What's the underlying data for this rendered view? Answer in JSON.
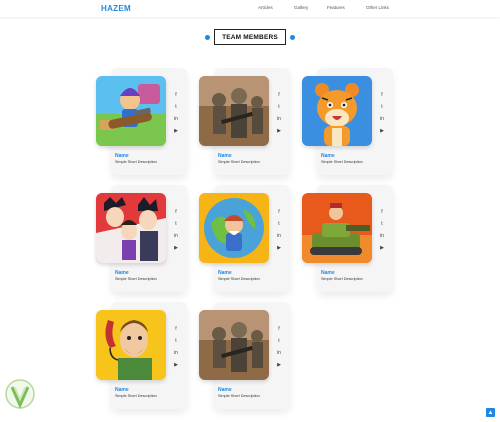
{
  "header": {
    "logo": "HAZEM",
    "nav": [
      {
        "label": "Articles"
      },
      {
        "label": "Gallery"
      },
      {
        "label": "Features"
      },
      {
        "label": "Other Links"
      }
    ]
  },
  "section": {
    "title": "TEAM MEMBERS"
  },
  "members": [
    {
      "name": "Name",
      "description": "Simple Short Description",
      "image": "boom-beach-warrior"
    },
    {
      "name": "Name",
      "description": "Simple Short Description",
      "image": "soldiers-battle"
    },
    {
      "name": "Name",
      "description": "Simple Short Description",
      "image": "cartoon-tiger"
    },
    {
      "name": "Name",
      "description": "Simple Short Description",
      "image": "anime-characters"
    },
    {
      "name": "Name",
      "description": "Simple Short Description",
      "image": "globe-adventurer"
    },
    {
      "name": "Name",
      "description": "Simple Short Description",
      "image": "tank-cartoon"
    },
    {
      "name": "Name",
      "description": "Simple Short Description",
      "image": "man-telephone"
    },
    {
      "name": "Name",
      "description": "Simple Short Description",
      "image": "soldiers-battle"
    }
  ],
  "social_icons": [
    "facebook-icon",
    "twitter-icon",
    "linkedin-icon",
    "youtube-icon"
  ],
  "social_glyphs": [
    "f",
    "t",
    "in",
    "▶"
  ],
  "colors": {
    "accent": "#1e88e5",
    "card": "#f5f5f5"
  }
}
